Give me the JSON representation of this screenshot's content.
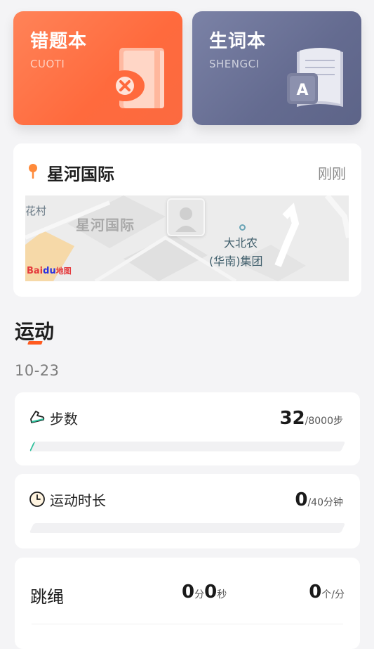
{
  "cards": {
    "cuoti": {
      "title": "错题本",
      "subtitle": "CUOTI"
    },
    "shengci": {
      "title": "生词本",
      "subtitle": "SHENGCI"
    }
  },
  "location": {
    "name": "星河国际",
    "time": "刚刚",
    "map": {
      "place_label": "星河国际",
      "edge_label": "花村",
      "poi_line1": "大北农",
      "poi_line2": "(华南)集团",
      "logo_bai": "Bai",
      "logo_du": "du",
      "logo_map": "地图"
    }
  },
  "sport": {
    "section_title": "运动",
    "date": "10-23",
    "steps": {
      "label": "步数",
      "value": "32",
      "target": "/8000步",
      "progress": 0.004
    },
    "duration": {
      "label": "运动时长",
      "value": "0",
      "target": "/40分钟",
      "progress": 0
    },
    "rope": {
      "label": "跳绳",
      "minutes": "0",
      "minutes_unit": "分",
      "seconds": "0",
      "seconds_unit": "秒",
      "count": "0",
      "count_unit": "个/分"
    }
  },
  "colors": {
    "cuoti_accent": "#ff6a3d",
    "shengci_accent": "#646b90",
    "section_accent": "#ff5a1f",
    "progress_fill": "#2bbf9a"
  }
}
